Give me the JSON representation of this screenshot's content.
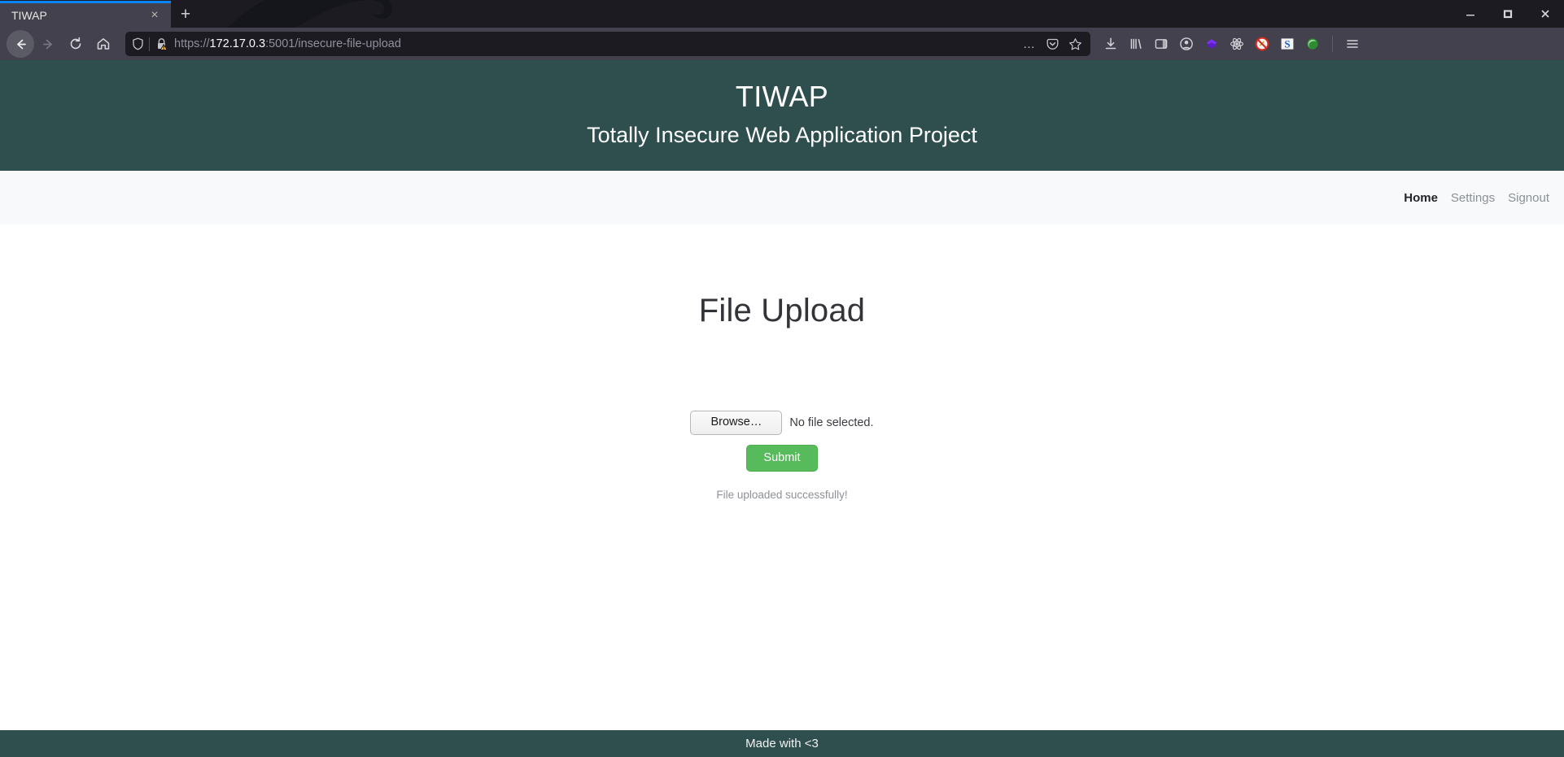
{
  "browser": {
    "tab": {
      "title": "TIWAP",
      "close_label": "×",
      "icon": "close-icon"
    },
    "new_tab_label": "+",
    "window_controls": {
      "minimize": "–",
      "maximize": "□",
      "close": "×"
    },
    "nav": {
      "back": "back-arrow-icon",
      "forward": "forward-arrow-icon",
      "reload": "reload-icon",
      "home": "home-icon"
    },
    "url": {
      "scheme": "https://",
      "host": "172.17.0.3",
      "rest": ":5001/insecure-file-upload",
      "full": "https://172.17.0.3:5001/insecure-file-upload",
      "shield_icon": "tracking-protection-shield-icon",
      "lock_icon": "insecure-lock-warning-icon"
    },
    "url_actions": {
      "more": "…",
      "pocket": "pocket-save-icon",
      "bookmark": "bookmark-star-icon"
    },
    "toolbar_icons": [
      {
        "name": "downloads-icon",
        "label": "⤓"
      },
      {
        "name": "library-icon",
        "label": "\\\\\\"
      },
      {
        "name": "sidebar-icon",
        "label": "sidebar"
      },
      {
        "name": "account-icon",
        "label": "account"
      },
      {
        "name": "extension-diamond-icon",
        "label": "diamond"
      },
      {
        "name": "react-devtools-icon",
        "label": "react"
      },
      {
        "name": "noscript-icon",
        "label": "noscript"
      },
      {
        "name": "extension-s-icon",
        "label": "S"
      },
      {
        "name": "wappalyzer-icon",
        "label": "globe"
      },
      {
        "name": "app-menu-icon",
        "label": "☰"
      }
    ]
  },
  "site": {
    "title": "TIWAP",
    "subtitle": "Totally Insecure Web Application Project",
    "nav_links": [
      {
        "label": "Home",
        "active": true
      },
      {
        "label": "Settings",
        "active": false
      },
      {
        "label": "Signout",
        "active": false
      }
    ],
    "page_title": "File Upload",
    "form": {
      "browse_label": "Browse…",
      "file_status": "No file selected.",
      "submit_label": "Submit",
      "message": "File uploaded successfully!"
    },
    "footer": "Made with <3"
  },
  "colors": {
    "header_bg": "#2f4f4f",
    "nav_bg": "#f8f9fa",
    "submit_green": "#57bb5c",
    "tab_accent": "#0a84ff",
    "message_grey": "#8d9196"
  }
}
